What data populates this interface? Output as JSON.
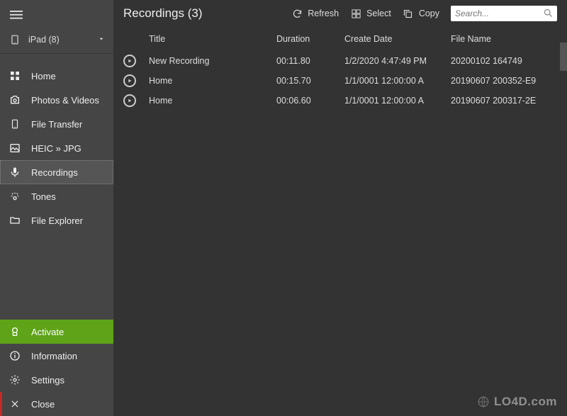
{
  "device": {
    "name": "iPad (8)"
  },
  "sidebar": {
    "items": [
      {
        "label": "Home"
      },
      {
        "label": "Photos & Videos"
      },
      {
        "label": "File Transfer"
      },
      {
        "label": "HEIC » JPG"
      },
      {
        "label": "Recordings"
      },
      {
        "label": "Tones"
      },
      {
        "label": "File Explorer"
      }
    ],
    "bottom": {
      "activate": "Activate",
      "information": "Information",
      "settings": "Settings",
      "close": "Close"
    }
  },
  "header": {
    "title": "Recordings (3)",
    "refresh": "Refresh",
    "select": "Select",
    "copy": "Copy"
  },
  "search": {
    "placeholder": "Search..."
  },
  "table": {
    "columns": {
      "title": "Title",
      "duration": "Duration",
      "create": "Create Date",
      "filename": "File Name"
    },
    "rows": [
      {
        "title": "New Recording",
        "duration": "00:11.80",
        "create": "1/2/2020 4:47:49 PM",
        "filename": "20200102 164749"
      },
      {
        "title": "Home",
        "duration": "00:15.70",
        "create": "1/1/0001 12:00:00 A",
        "filename": "20190607 200352-E9"
      },
      {
        "title": "Home",
        "duration": "00:06.60",
        "create": "1/1/0001 12:00:00 A",
        "filename": "20190607 200317-2E"
      }
    ]
  },
  "watermark": "LO4D.com"
}
